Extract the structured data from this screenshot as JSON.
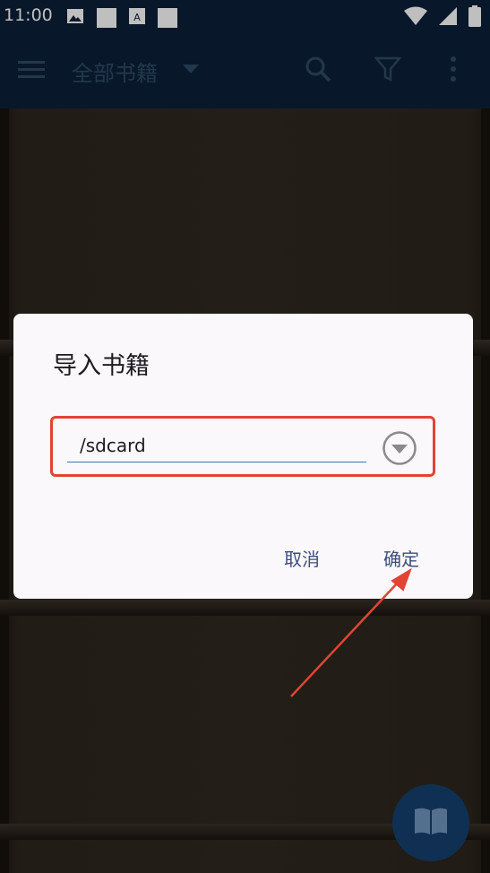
{
  "status_bar": {
    "time": "11:00",
    "left_icons": [
      "image-icon",
      "square-icon",
      "font-icon",
      "square-icon"
    ],
    "right_icons": [
      "wifi-icon",
      "signal-icon",
      "battery-icon"
    ]
  },
  "app_bar": {
    "title": "全部书籍",
    "icons": [
      "menu-icon",
      "dropdown-icon",
      "search-icon",
      "filter-icon",
      "more-icon"
    ]
  },
  "dialog": {
    "title": "导入书籍",
    "path_value": "/sdcard",
    "cancel_label": "取消",
    "ok_label": "确定"
  },
  "fab": {
    "icon": "book-icon"
  },
  "colors": {
    "app_bar": "#0b2139",
    "dialog_bg": "#fbf8fb",
    "highlight": "#e04533",
    "button_text": "#3b4e7a",
    "input_underline": "#3a78c2"
  }
}
